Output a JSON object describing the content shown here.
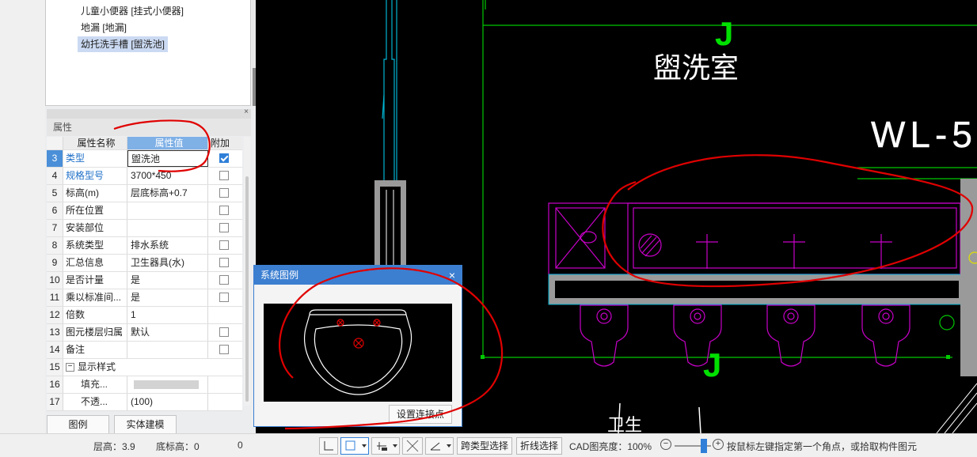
{
  "tree": {
    "items": [
      {
        "label": "儿童小便器 [挂式小便器]",
        "selected": false
      },
      {
        "label": "地漏 [地漏]",
        "selected": false
      },
      {
        "label": "幼托洗手槽 [盥洗池]",
        "selected": true
      }
    ]
  },
  "properties": {
    "title": "属性",
    "close": "×",
    "columns": {
      "name": "属性名称",
      "value": "属性值",
      "extra": "附加"
    },
    "rows": [
      {
        "num": "3",
        "name": "类型",
        "value": "盥洗池",
        "checked": true,
        "blue": true,
        "selected": true
      },
      {
        "num": "4",
        "name": "规格型号",
        "value": "3700*450",
        "checked": false,
        "blue": true
      },
      {
        "num": "5",
        "name": "标高(m)",
        "value": "层底标高+0.7",
        "checked": false
      },
      {
        "num": "6",
        "name": "所在位置",
        "value": "",
        "checked": false
      },
      {
        "num": "7",
        "name": "安装部位",
        "value": "",
        "checked": false
      },
      {
        "num": "8",
        "name": "系统类型",
        "value": "排水系统",
        "checked": false
      },
      {
        "num": "9",
        "name": "汇总信息",
        "value": "卫生器具(水)",
        "checked": false
      },
      {
        "num": "10",
        "name": "是否计量",
        "value": "是",
        "checked": false
      },
      {
        "num": "11",
        "name": "乘以标准间...",
        "value": "是",
        "checked": false
      },
      {
        "num": "12",
        "name": "倍数",
        "value": "1"
      },
      {
        "num": "13",
        "name": "图元楼层归属",
        "value": "默认",
        "checked": false
      },
      {
        "num": "14",
        "name": "备注",
        "value": "",
        "checked": false
      },
      {
        "num": "15",
        "name": "显示样式",
        "value": ""
      },
      {
        "num": "16",
        "name": "填充...",
        "value": ""
      },
      {
        "num": "17",
        "name": "不透...",
        "value": "(100)"
      }
    ],
    "buttons": {
      "legend": "图例",
      "solid_model": "实体建模"
    }
  },
  "popup": {
    "title": "系统图例",
    "close": "×",
    "button": "设置连接点"
  },
  "cad": {
    "room_label": "盥洗室",
    "pipe_label": "WL-5",
    "marker_top": "J",
    "marker_bottom": "J",
    "partial_label": "卫生"
  },
  "statusbar": {
    "floor_height": "层高：3.9",
    "base_height": "底标高：0",
    "value": "0",
    "cross_type_select": "跨类型选择",
    "polyline_select": "折线选择",
    "cad_brightness": "CAD图亮度：100%",
    "hint": "按鼠标左键指定第一个角点，或拾取构件图元"
  },
  "colors": {
    "accent": "#3c7fd1",
    "cad_bg": "#000000",
    "cad_green": "#00c800",
    "cad_magenta": "#c800c8",
    "cad_cyan": "#00b4d2",
    "annotation_red": "#e00000"
  }
}
